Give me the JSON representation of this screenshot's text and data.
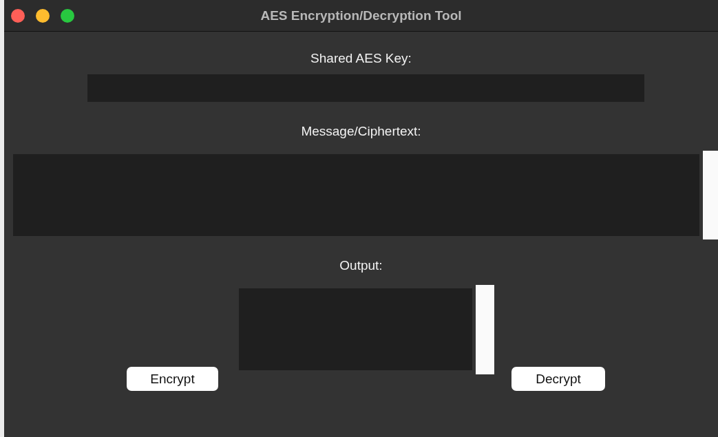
{
  "window": {
    "title": "AES Encryption/Decryption Tool"
  },
  "key_field": {
    "label": "Shared AES Key:"
  },
  "message_field": {
    "label": "Message/Ciphertext:"
  },
  "output_field": {
    "label": "Output:"
  },
  "buttons": [
    {
      "kind": "encrypt",
      "label": "Encrypt"
    },
    {
      "kind": "decrypt",
      "label": "Decrypt"
    }
  ]
}
